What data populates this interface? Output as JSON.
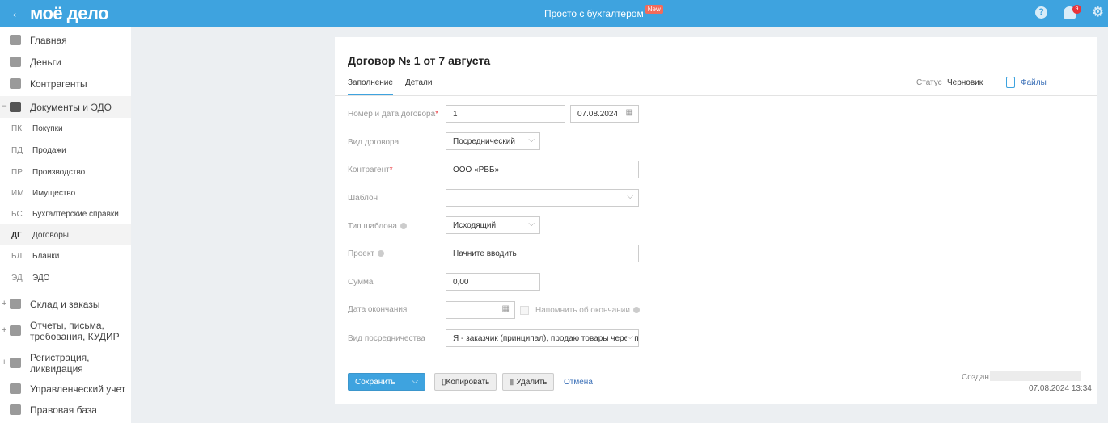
{
  "header": {
    "logo": "моё дело",
    "center": "Просто с бухгалтером",
    "new_badge": "New",
    "notifications": "9",
    "icons": [
      "back-arrow-icon",
      "help-icon",
      "bell-icon",
      "gear-icon"
    ]
  },
  "sidebar": {
    "items": [
      {
        "label": "Главная",
        "icon": "home-icon"
      },
      {
        "label": "Деньги",
        "icon": "money-icon"
      },
      {
        "label": "Контрагенты",
        "icon": "contractors-icon"
      },
      {
        "label": "Документы и ЭДО",
        "icon": "folder-icon",
        "active": true,
        "toggle": "–"
      }
    ],
    "sub": [
      {
        "ab": "ПК",
        "label": "Покупки"
      },
      {
        "ab": "ПД",
        "label": "Продажи"
      },
      {
        "ab": "ПР",
        "label": "Производство"
      },
      {
        "ab": "ИМ",
        "label": "Имущество"
      },
      {
        "ab": "БС",
        "label": "Бухгалтерские справки"
      },
      {
        "ab": "ДГ",
        "label": "Договоры",
        "active": true
      },
      {
        "ab": "БЛ",
        "label": "Бланки"
      },
      {
        "ab": "ЭД",
        "label": "ЭДО"
      }
    ],
    "more": [
      {
        "label": "Склад и заказы",
        "l2": "",
        "toggle": "+"
      },
      {
        "label": "Отчеты, письма,",
        "l2": "требования, КУДИР",
        "toggle": "+"
      },
      {
        "label": "Регистрация,",
        "l2": "ликвидация",
        "toggle": "+"
      },
      {
        "label": "Управленческий учет",
        "l2": "",
        "toggle": ""
      },
      {
        "label": "Правовая база",
        "l2": "",
        "toggle": ""
      }
    ]
  },
  "doc": {
    "title": "Договор № 1 от 7 августа",
    "tabs": [
      "Заполнение",
      "Детали"
    ],
    "status_label": "Статус",
    "status": "Черновик",
    "files": "Файлы",
    "fields": {
      "number_label": "Номер и дата договора",
      "number": "1",
      "date": "07.08.2024",
      "type_label": "Вид договора",
      "type": "Посреднический",
      "contractor_label": "Контрагент",
      "contractor": "ООО «РВБ»",
      "template_label": "Шаблон",
      "template": "",
      "template_type_label": "Тип шаблона",
      "template_type": "Исходящий",
      "project_label": "Проект",
      "project_placeholder": "Начните вводить",
      "sum_label": "Сумма",
      "sum": "0,00",
      "end_label": "Дата окончания",
      "end": "",
      "remind": "Напомнить об окончании",
      "mediation_label": "Вид посредничества",
      "mediation": "Я - заказчик (принципал), продаю товары через п..."
    }
  },
  "footer": {
    "save": "Сохранить",
    "copy": "Копировать",
    "delete": "Удалить",
    "cancel": "Отмена",
    "created_label": "Создан:",
    "created_at": "07.08.2024 13:34"
  }
}
